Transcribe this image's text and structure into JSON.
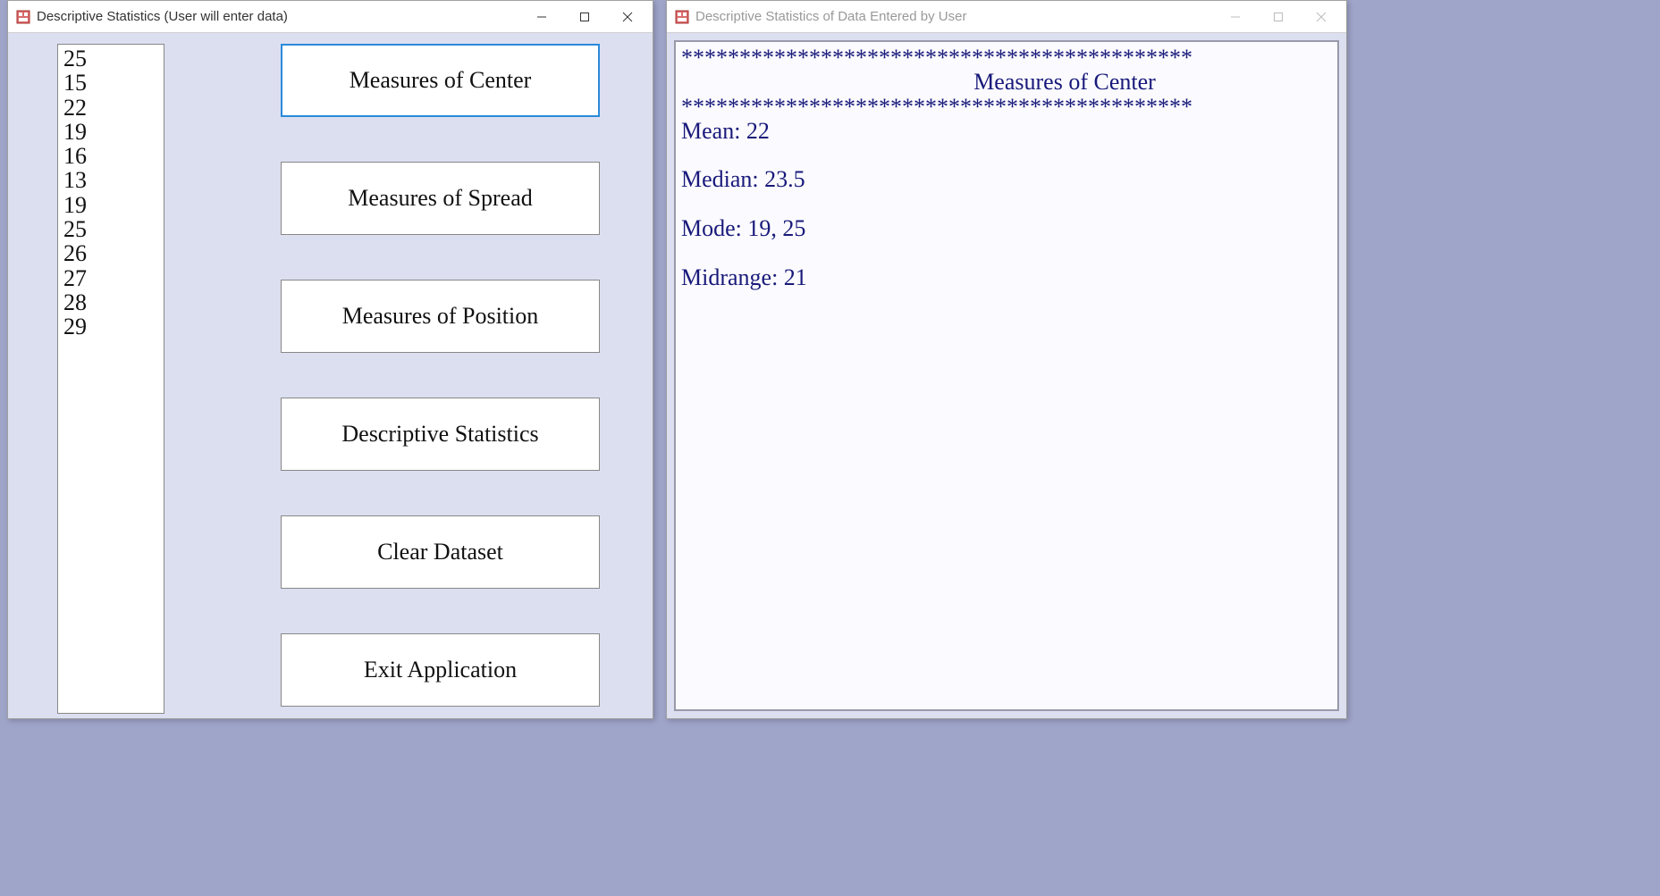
{
  "window_left": {
    "title": "Descriptive Statistics (User will enter data)",
    "data_values": [
      "25",
      "15",
      "22",
      "19",
      "16",
      "13",
      "19",
      "25",
      "26",
      "27",
      "28",
      "29"
    ],
    "buttons": {
      "center": "Measures of Center",
      "spread": "Measures of Spread",
      "position": "Measures of Position",
      "descriptive": "Descriptive Statistics",
      "clear": "Clear Dataset",
      "exit": "Exit Application"
    }
  },
  "window_right": {
    "title": "Descriptive Statistics of Data Entered by User",
    "output": {
      "stars": "********************************************",
      "heading": "Measures of Center",
      "mean": "Mean: 22",
      "median": "Median: 23.5",
      "mode": "Mode: 19, 25",
      "midrange": "Midrange: 21"
    }
  }
}
